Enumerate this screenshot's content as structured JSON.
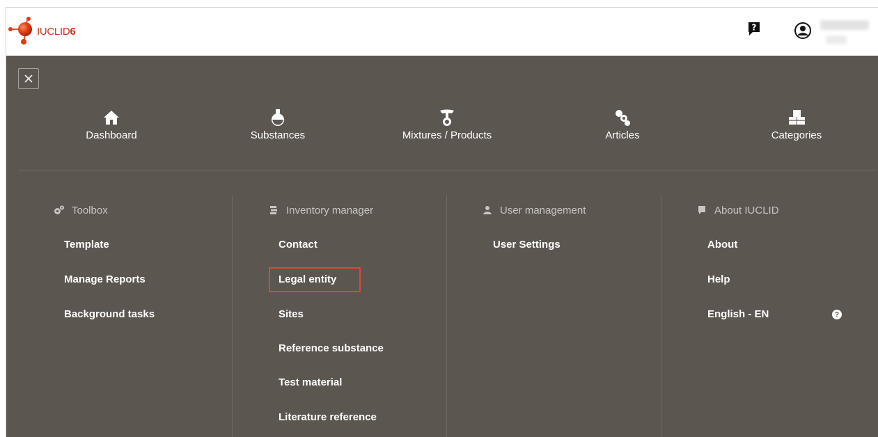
{
  "header": {
    "logo_text": "IUCLID",
    "logo_version": "6",
    "help_icon": "help-bubble-icon",
    "user_icon": "user-avatar-icon"
  },
  "menu": {
    "close_icon": "close-icon",
    "nav": [
      {
        "label": "Dashboard",
        "icon": "home-icon"
      },
      {
        "label": "Substances",
        "icon": "flask-icon"
      },
      {
        "label": "Mixtures / Products",
        "icon": "mixture-icon"
      },
      {
        "label": "Articles",
        "icon": "articles-icon"
      },
      {
        "label": "Categories",
        "icon": "categories-icon"
      }
    ],
    "columns": [
      {
        "heading": "Toolbox",
        "icon": "gears-icon",
        "links": [
          "Template",
          "Manage Reports",
          "Background tasks"
        ]
      },
      {
        "heading": "Inventory manager",
        "icon": "stack-icon",
        "links": [
          "Contact",
          "Legal entity",
          "Sites",
          "Reference substance",
          "Test material",
          "Literature reference"
        ]
      },
      {
        "heading": "User management",
        "icon": "user-icon",
        "links": [
          "User Settings"
        ]
      },
      {
        "heading": "About IUCLID",
        "icon": "info-bubble-icon",
        "links": [
          "About",
          "Help",
          "English - EN"
        ]
      }
    ],
    "highlighted_link": "Legal entity",
    "language_help_icon": "question-circle-icon"
  },
  "colors": {
    "menu_bg": "#5c5651",
    "brand": "#c8341f",
    "highlight": "#e0443b"
  }
}
